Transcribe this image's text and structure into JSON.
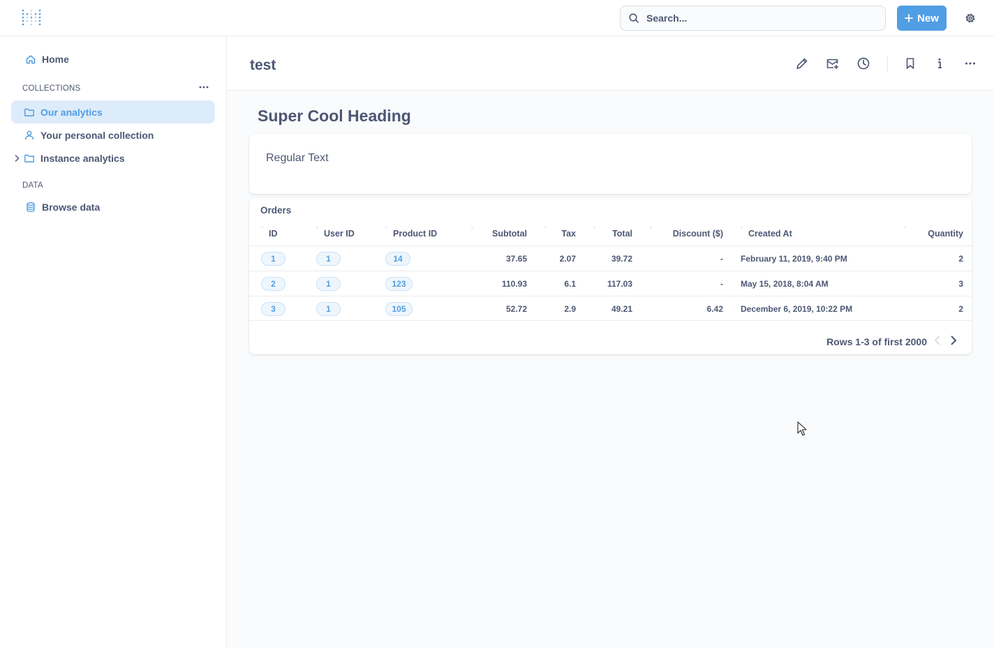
{
  "topbar": {
    "search_placeholder": "Search...",
    "new_label": "New",
    "accent": "#509ee3"
  },
  "sidebar": {
    "home": "Home",
    "collections_label": "COLLECTIONS",
    "items": [
      {
        "label": "Our analytics",
        "icon": "folder-icon",
        "active": true
      },
      {
        "label": "Your personal collection",
        "icon": "person-icon"
      },
      {
        "label": "Instance analytics",
        "icon": "folder-icon"
      }
    ],
    "data_label": "DATA",
    "browse_data": "Browse data"
  },
  "header": {
    "title": "test",
    "icons": [
      "pencil-icon",
      "calendar-add-icon",
      "clock-icon",
      "bookmark-icon",
      "info-icon",
      "more-icon"
    ]
  },
  "content": {
    "heading": "Super Cool Heading",
    "text": "Regular Text"
  },
  "table": {
    "title": "Orders",
    "columns": [
      "ID",
      "User ID",
      "Product ID",
      "Subtotal",
      "Tax",
      "Total",
      "Discount ($)",
      "Created At",
      "Quantity"
    ],
    "rows": [
      {
        "id": "1",
        "user_id": "1",
        "product_id": "14",
        "subtotal": "37.65",
        "tax": "2.07",
        "total": "39.72",
        "discount": "-",
        "created_at": "February 11, 2019, 9:40 PM",
        "quantity": "2"
      },
      {
        "id": "2",
        "user_id": "1",
        "product_id": "123",
        "subtotal": "110.93",
        "tax": "6.1",
        "total": "117.03",
        "discount": "-",
        "created_at": "May 15, 2018, 8:04 AM",
        "quantity": "3"
      },
      {
        "id": "3",
        "user_id": "1",
        "product_id": "105",
        "subtotal": "52.72",
        "tax": "2.9",
        "total": "49.21",
        "discount": "6.42",
        "created_at": "December 6, 2019, 10:22 PM",
        "quantity": "2"
      }
    ],
    "pagination": "Rows 1-3 of first 2000"
  }
}
